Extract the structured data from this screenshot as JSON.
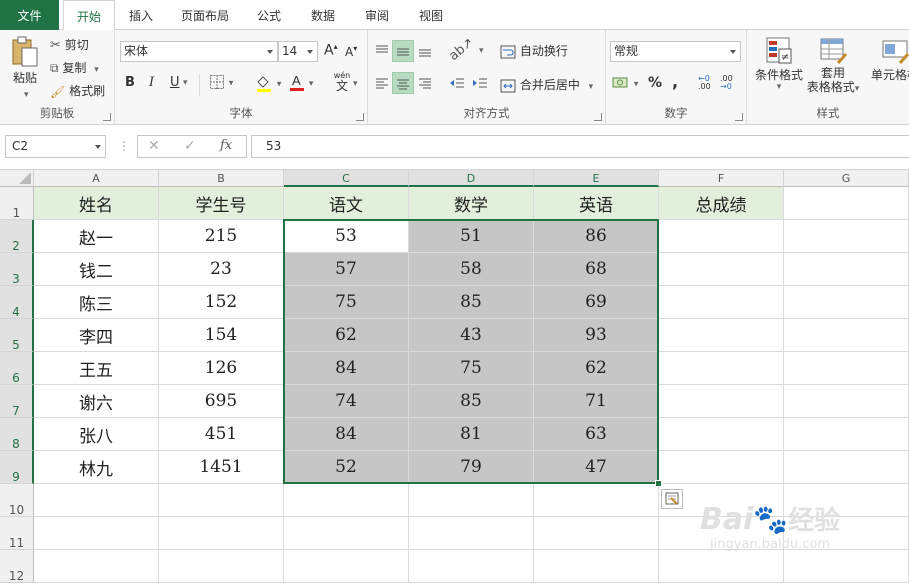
{
  "tabs": [
    "文件",
    "开始",
    "插入",
    "页面布局",
    "公式",
    "数据",
    "审阅",
    "视图"
  ],
  "active_tab": "开始",
  "ribbon": {
    "clipboard": {
      "label": "剪贴板",
      "paste": "粘贴",
      "cut": "剪切",
      "copy": "复制",
      "format_painter": "格式刷"
    },
    "font": {
      "label": "字体",
      "font_name": "宋体",
      "font_size": "14",
      "grow": "A",
      "shrink": "A",
      "bold": "B",
      "italic": "I",
      "underline": "U",
      "wen": "wén",
      "wen_char": "文"
    },
    "alignment": {
      "label": "对齐方式",
      "wrap_text": "自动换行",
      "merge_center": "合并后居中"
    },
    "number": {
      "label": "数字",
      "format": "常规",
      "percent": "%",
      "comma": ",",
      "inc_decimal": ".00",
      "dec_decimal": ".00"
    },
    "styles": {
      "label": "样式",
      "conditional": "条件格式",
      "table_format_1": "套用",
      "table_format_2": "表格格式",
      "cell_styles": "单元格样"
    }
  },
  "formula_bar": {
    "name_box": "C2",
    "fx": "fx",
    "value": "53"
  },
  "columns": [
    "A",
    "B",
    "C",
    "D",
    "E",
    "F",
    "G"
  ],
  "rows": [
    "1",
    "2",
    "3",
    "4",
    "5",
    "6",
    "7",
    "8",
    "9",
    "10",
    "11",
    "12"
  ],
  "header_row": [
    "姓名",
    "学生号",
    "语文",
    "数学",
    "英语",
    "总成绩"
  ],
  "data_rows": [
    [
      "赵一",
      "215",
      "53",
      "51",
      "86"
    ],
    [
      "钱二",
      "23",
      "57",
      "58",
      "68"
    ],
    [
      "陈三",
      "152",
      "75",
      "85",
      "69"
    ],
    [
      "李四",
      "154",
      "62",
      "43",
      "93"
    ],
    [
      "王五",
      "126",
      "84",
      "75",
      "62"
    ],
    [
      "谢六",
      "695",
      "74",
      "85",
      "71"
    ],
    [
      "张八",
      "451",
      "84",
      "81",
      "63"
    ],
    [
      "林九",
      "1451",
      "52",
      "79",
      "47"
    ]
  ],
  "watermark": {
    "brand": "Bai",
    "brand2": "经验",
    "url": "jingyan.baidu.com"
  },
  "colors": {
    "accent": "#217346",
    "header_fill": "#e2efda",
    "selection_fill": "#c6c6c6"
  }
}
